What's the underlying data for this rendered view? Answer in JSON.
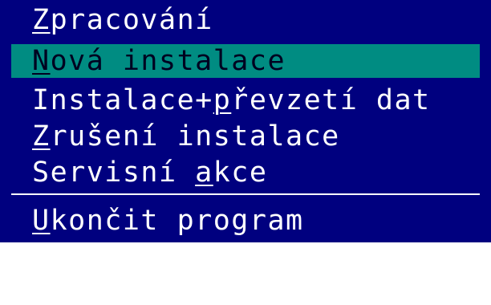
{
  "colors": {
    "menu_background": "#00007f",
    "menu_text": "#ffffff",
    "selected_background": "#008c82",
    "selected_text": "#000020"
  },
  "menu": {
    "items": [
      {
        "mnemonic": "Z",
        "rest": "pracování",
        "selected": false
      },
      {
        "mnemonic": "N",
        "rest": "ová instalace",
        "selected": true
      },
      {
        "prefix": "Instalace+",
        "mnemonic": "p",
        "rest": "řevzetí dat",
        "selected": false
      },
      {
        "mnemonic": "Z",
        "rest": "rušení instalace",
        "selected": false
      },
      {
        "prefix": "Servisní ",
        "mnemonic": "a",
        "rest": "kce",
        "selected": false
      }
    ],
    "exit_item": {
      "mnemonic": "U",
      "rest": "končit program"
    }
  }
}
